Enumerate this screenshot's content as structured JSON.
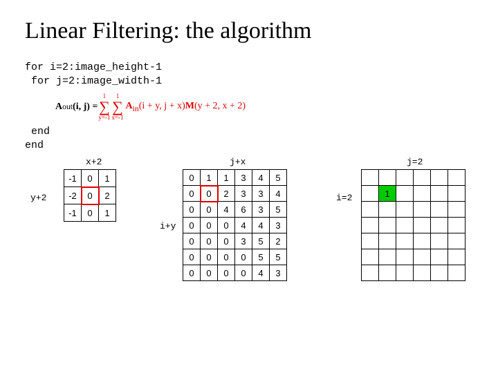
{
  "title": "Linear Filtering: the algorithm",
  "code": {
    "l1": "for i=2:image_height-1",
    "l2": " for j=2:image_width-1",
    "l3": " end",
    "l4": "end"
  },
  "formula": {
    "lhs": "A",
    "lhs_sub": "out",
    "lhs_args": "(i, j) = ",
    "sum1_top": "1",
    "sum1_bot": "y=-1",
    "sum2_top": "1",
    "sum2_bot": "x=-1",
    "rhs_A": "A",
    "rhs_Asub": "in",
    "rhs_Aargs": "(i + y, j + x)",
    "rhs_M": "M",
    "rhs_Margs": "(y + 2, x + 2)"
  },
  "labels": {
    "xp2": "x+2",
    "yp2": "y+2",
    "jpx": "j+x",
    "ipy": "i+y",
    "jeq2": "j=2",
    "ieq2": "i=2"
  },
  "kernel": [
    [
      "-1",
      "0",
      "1"
    ],
    [
      "-2",
      "0",
      "2"
    ],
    [
      "-1",
      "0",
      "1"
    ]
  ],
  "image": [
    [
      "0",
      "1",
      "1",
      "3",
      "4",
      "5"
    ],
    [
      "0",
      "0",
      "2",
      "3",
      "3",
      "4"
    ],
    [
      "0",
      "0",
      "4",
      "6",
      "3",
      "5"
    ],
    [
      "0",
      "0",
      "0",
      "4",
      "4",
      "3"
    ],
    [
      "0",
      "0",
      "0",
      "3",
      "5",
      "2"
    ],
    [
      "0",
      "0",
      "0",
      "0",
      "5",
      "5"
    ],
    [
      "0",
      "0",
      "0",
      "0",
      "4",
      "3"
    ]
  ],
  "output_value": "1",
  "chart_data": {
    "type": "table",
    "title": "Linear filtering convolution step",
    "kernel": [
      [
        -1,
        0,
        1
      ],
      [
        -2,
        0,
        2
      ],
      [
        -1,
        0,
        1
      ]
    ],
    "kernel_highlight": {
      "row": 1,
      "col": 1
    },
    "image": [
      [
        0,
        1,
        1,
        3,
        4,
        5
      ],
      [
        0,
        0,
        2,
        3,
        3,
        4
      ],
      [
        0,
        0,
        4,
        6,
        3,
        5
      ],
      [
        0,
        0,
        0,
        4,
        4,
        3
      ],
      [
        0,
        0,
        0,
        3,
        5,
        2
      ],
      [
        0,
        0,
        0,
        0,
        5,
        5
      ],
      [
        0,
        0,
        0,
        0,
        4,
        3
      ]
    ],
    "image_highlight": {
      "row": 1,
      "col": 1
    },
    "output_grid_size": {
      "rows": 7,
      "cols": 6
    },
    "output_highlight": {
      "row": 1,
      "col": 1,
      "value": 1
    },
    "current_indices": {
      "i": 2,
      "j": 2
    }
  }
}
